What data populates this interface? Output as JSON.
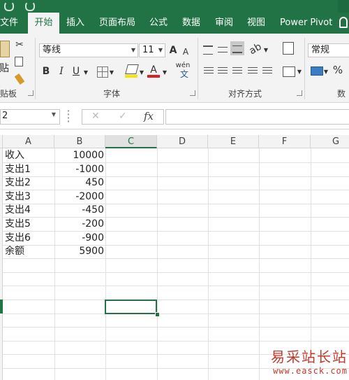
{
  "tabs": [
    {
      "label": "文件",
      "active": false
    },
    {
      "label": "开始",
      "active": true
    },
    {
      "label": "插入",
      "active": false
    },
    {
      "label": "页面布局",
      "active": false
    },
    {
      "label": "公式",
      "active": false
    },
    {
      "label": "数据",
      "active": false
    },
    {
      "label": "审阅",
      "active": false
    },
    {
      "label": "视图",
      "active": false
    },
    {
      "label": "Power Pivot",
      "active": false
    }
  ],
  "ribbon": {
    "clipboard": {
      "label": "贴板",
      "paste_label": "贴"
    },
    "font": {
      "label": "字体",
      "font_name": "等线",
      "font_size": "11",
      "bold": "B",
      "italic": "I",
      "underline": "U",
      "grow": "A",
      "shrink": "A",
      "font_color": "A",
      "phonetic": "wén"
    },
    "alignment": {
      "label": "对齐方式"
    },
    "number": {
      "label": "数",
      "format": "常规",
      "percent": "%"
    }
  },
  "formula_bar": {
    "name_box": "2",
    "cancel": "✕",
    "enter": "✓",
    "fx": "fx",
    "content": ""
  },
  "columns": [
    "A",
    "B",
    "C",
    "D",
    "E",
    "F",
    "G"
  ],
  "selected_column": "C",
  "rows": [
    {
      "a": "收入",
      "b": "10000"
    },
    {
      "a": "支出1",
      "b": "-1000"
    },
    {
      "a": "支出2",
      "b": "450"
    },
    {
      "a": "支出3",
      "b": "-2000"
    },
    {
      "a": "支出4",
      "b": "-450"
    },
    {
      "a": "支出5",
      "b": "-200"
    },
    {
      "a": "支出6",
      "b": "-900"
    },
    {
      "a": "余额",
      "b": "5900"
    }
  ],
  "watermark": {
    "name": "易采站长站",
    "url": "www.easck.com"
  },
  "colors": {
    "excel_green": "#217346",
    "header_bg": "#f3f3f3",
    "gridline": "#e1e1e1"
  }
}
